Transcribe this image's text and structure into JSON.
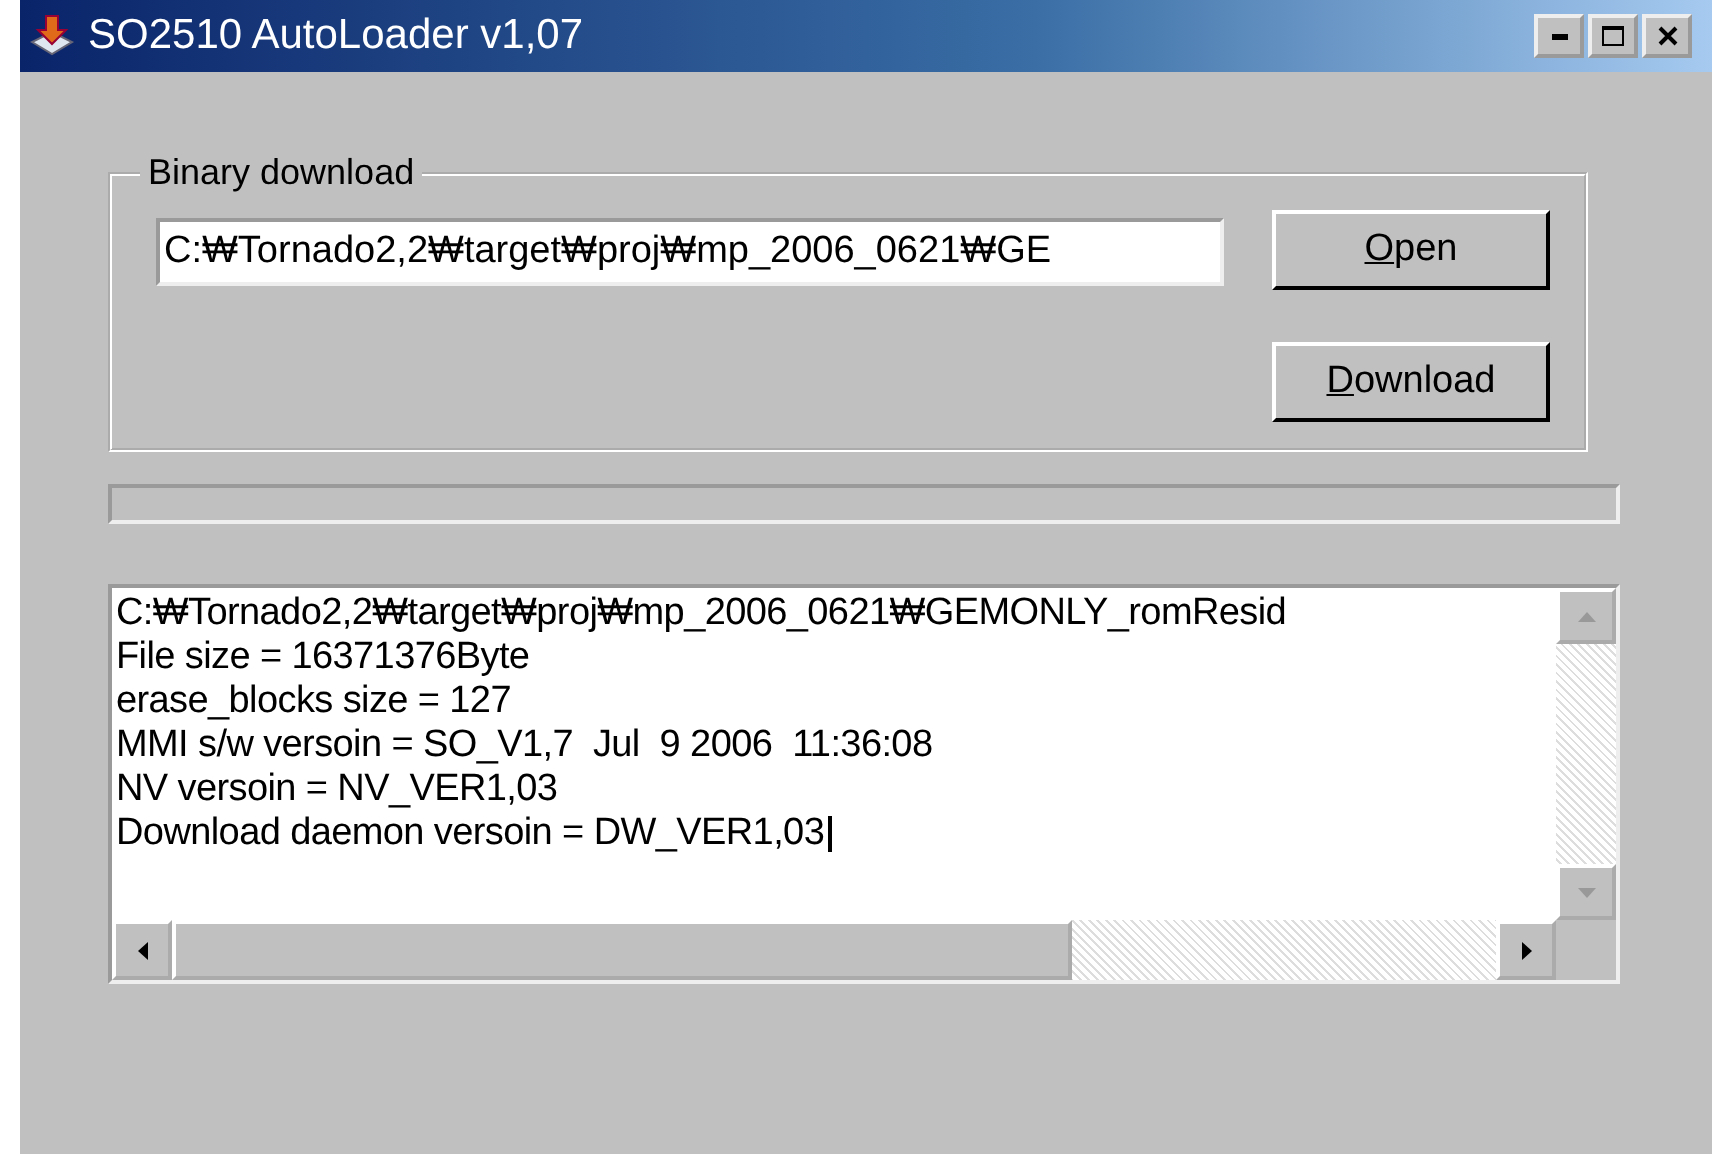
{
  "window": {
    "title": "SO2510 AutoLoader v1,07"
  },
  "binary_download": {
    "legend": "Binary download",
    "path": "C:₩Tornado2,2₩target₩proj₩mp_2006_0621₩GE",
    "buttons": [
      "Open",
      "Download"
    ]
  },
  "progress": {
    "level": 0
  },
  "log": {
    "lines": [
      "C:₩Tornado2,2₩target₩proj₩mp_2006_0621₩GEMONLY_romResid",
      "File size = 16371376Byte",
      "erase_blocks size = 127",
      "MMI s/w versoin = SO_V1,7  Jul  9 2006  11:36:08",
      "NV versoin = NV_VER1,03",
      "Download daemon versoin = DW_VER1,03"
    ]
  }
}
